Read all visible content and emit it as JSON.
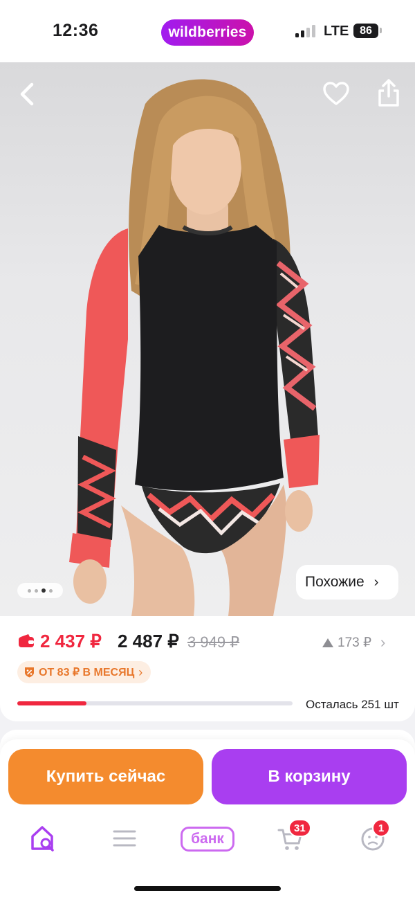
{
  "status_bar": {
    "time": "12:36",
    "app_label": "wildberries",
    "network": "LTE",
    "battery": "86"
  },
  "product_image": {
    "similar_label": "Похожие",
    "similar_chevron": "›",
    "page_count": 4,
    "active_page": 3,
    "icons": [
      "chevron-left-icon",
      "heart-icon",
      "share-icon"
    ]
  },
  "price": {
    "wallet_price": "2 437 ₽",
    "price": "2 487 ₽",
    "old_price": "3 949 ₽",
    "price_drop": "173 ₽",
    "installment": "ОТ 83 ₽ В МЕСЯЦ",
    "stock_label": "Осталась 251 шт",
    "stock_fraction": 0.25,
    "accent_color": "#f0273f"
  },
  "actions": {
    "buy_now": "Купить сейчас",
    "add_to_cart": "В корзину",
    "buy_now_color": "#f48b2e",
    "add_to_cart_color": "#a93ef0"
  },
  "tab_bar": {
    "bank_label": "банк",
    "cart_badge": "31",
    "profile_badge": "1",
    "icons": [
      "home-search-icon",
      "menu-icon",
      "bank-icon",
      "cart-icon",
      "profile-icon"
    ]
  }
}
